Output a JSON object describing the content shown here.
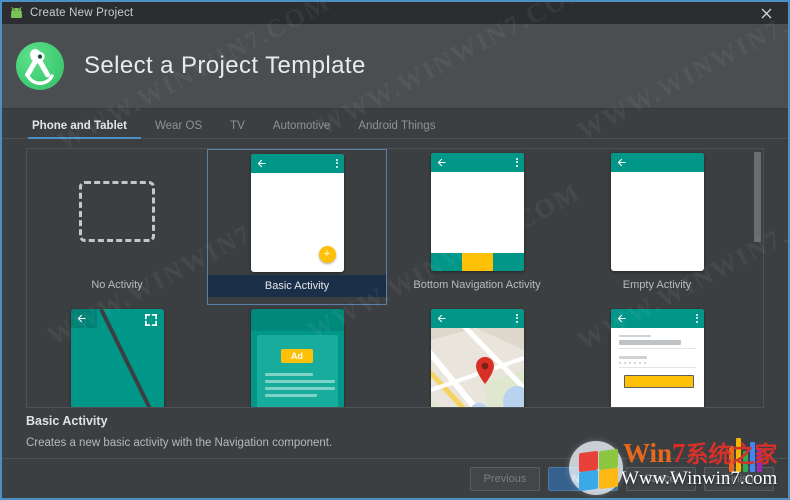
{
  "window": {
    "title": "Create New Project",
    "close_label": "✕",
    "app_icon": "android-robot-icon"
  },
  "header": {
    "heading": "Select a Project Template",
    "logo": "android-studio-logo"
  },
  "tabs": [
    {
      "label": "Phone and Tablet",
      "active": true
    },
    {
      "label": "Wear OS",
      "active": false
    },
    {
      "label": "TV",
      "active": false
    },
    {
      "label": "Automotive",
      "active": false
    },
    {
      "label": "Android Things",
      "active": false
    }
  ],
  "templates": [
    {
      "label": "No Activity",
      "kind": "no-activity",
      "selected": false
    },
    {
      "label": "Basic Activity",
      "kind": "basic",
      "selected": true
    },
    {
      "label": "Bottom Navigation Activity",
      "kind": "bottom-nav",
      "selected": false
    },
    {
      "label": "Empty Activity",
      "kind": "empty",
      "selected": false
    },
    {
      "label": "",
      "kind": "fullscreen",
      "selected": false
    },
    {
      "label": "",
      "kind": "ads",
      "selected": false
    },
    {
      "label": "",
      "kind": "maps",
      "selected": false
    },
    {
      "label": "",
      "kind": "login",
      "selected": false
    }
  ],
  "ads_badge": "Ad",
  "fab_glyph": "+",
  "description": {
    "title": "Basic Activity",
    "text": "Creates a new basic activity with the Navigation component."
  },
  "footer": {
    "previous": "Previous",
    "next": "Next",
    "cancel": "Cancel",
    "finish": "Finish"
  },
  "watermarks": {
    "w1": "WWW.WINWIN7.COM",
    "w2": "WWW.WINWIN7.COM",
    "w3": "WWW.WINWIN7.COM",
    "w4": "WWW.WINWIN7.COM",
    "w5": "WWW.WINWIN7.COM",
    "w6": "WWW.WINWIN7.COM"
  },
  "brand": {
    "win": "Win",
    "seven": "7",
    "chinese": "系统之家",
    "url": "Www.Winwin7.com"
  },
  "colors": {
    "accent_blue": "#4a90c4",
    "teal": "#009688",
    "amber": "#ffc107",
    "panel": "#3c3f41",
    "header": "#4b4e51",
    "selected_label_bg": "#1b3048"
  }
}
